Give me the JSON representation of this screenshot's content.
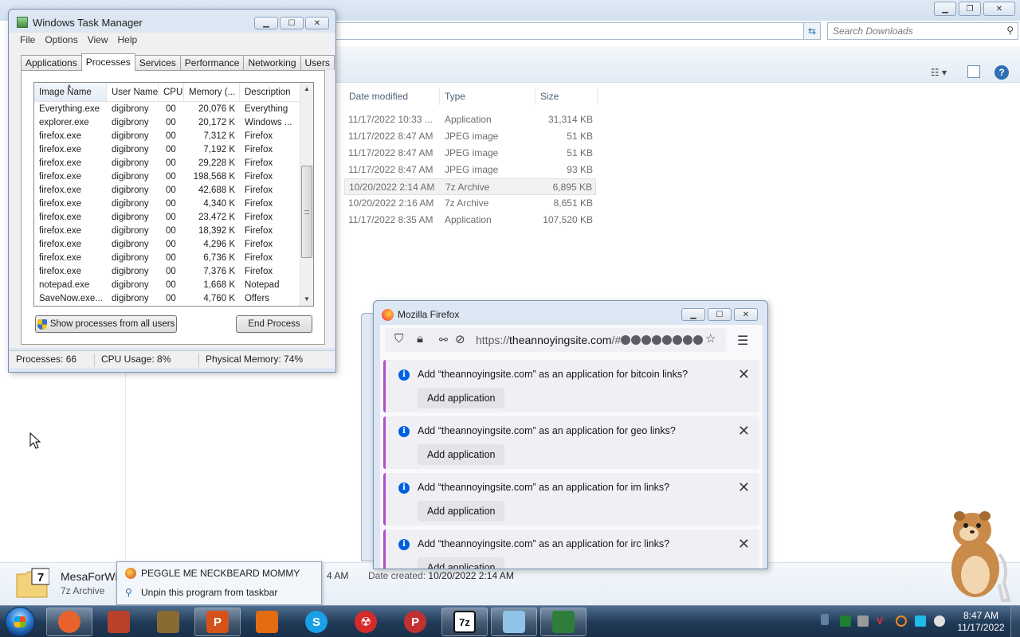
{
  "explorer": {
    "search_placeholder": "Search Downloads",
    "columns": [
      "Date modified",
      "Type",
      "Size"
    ],
    "files": [
      {
        "date": "11/17/2022 10:33 ...",
        "type": "Application",
        "size": "31,314 KB"
      },
      {
        "date": "11/17/2022 8:47 AM",
        "type": "JPEG image",
        "size": "51 KB"
      },
      {
        "date": "11/17/2022 8:47 AM",
        "type": "JPEG image",
        "size": "51 KB"
      },
      {
        "date": "11/17/2022 8:47 AM",
        "type": "JPEG image",
        "size": "93 KB"
      },
      {
        "date": "10/20/2022 2:14 AM",
        "type": "7z Archive",
        "size": "6,895 KB"
      },
      {
        "date": "10/20/2022 2:16 AM",
        "type": "7z Archive",
        "size": "8,651 KB"
      },
      {
        "date": "11/17/2022 8:35 AM",
        "type": "Application",
        "size": "107,520 KB"
      }
    ],
    "details": {
      "file_name": "MesaForWin",
      "file_type": "7z Archive",
      "time_fragment": "4 AM",
      "date_created_label": "Date created:",
      "date_created_value": "10/20/2022 2:14 AM"
    }
  },
  "taskmgr": {
    "title": "Windows Task Manager",
    "menu": [
      "File",
      "Options",
      "View",
      "Help"
    ],
    "tabs": [
      "Applications",
      "Processes",
      "Services",
      "Performance",
      "Networking",
      "Users"
    ],
    "columns": [
      "Image Name",
      "User Name",
      "CPU",
      "Memory (...",
      "Description"
    ],
    "processes": [
      [
        "Everything.exe",
        "digibrony",
        "00",
        "20,076 K",
        "Everything"
      ],
      [
        "explorer.exe",
        "digibrony",
        "00",
        "20,172 K",
        "Windows ..."
      ],
      [
        "firefox.exe",
        "digibrony",
        "00",
        "7,312 K",
        "Firefox"
      ],
      [
        "firefox.exe",
        "digibrony",
        "00",
        "7,192 K",
        "Firefox"
      ],
      [
        "firefox.exe",
        "digibrony",
        "00",
        "29,228 K",
        "Firefox"
      ],
      [
        "firefox.exe",
        "digibrony",
        "00",
        "198,568 K",
        "Firefox"
      ],
      [
        "firefox.exe",
        "digibrony",
        "00",
        "42,688 K",
        "Firefox"
      ],
      [
        "firefox.exe",
        "digibrony",
        "00",
        "4,340 K",
        "Firefox"
      ],
      [
        "firefox.exe",
        "digibrony",
        "00",
        "23,472 K",
        "Firefox"
      ],
      [
        "firefox.exe",
        "digibrony",
        "00",
        "18,392 K",
        "Firefox"
      ],
      [
        "firefox.exe",
        "digibrony",
        "00",
        "4,296 K",
        "Firefox"
      ],
      [
        "firefox.exe",
        "digibrony",
        "00",
        "6,736 K",
        "Firefox"
      ],
      [
        "firefox.exe",
        "digibrony",
        "00",
        "7,376 K",
        "Firefox"
      ],
      [
        "notepad.exe",
        "digibrony",
        "00",
        "1,668 K",
        "Notepad"
      ],
      [
        "SaveNow.exe...",
        "digibrony",
        "00",
        "4,760 K",
        "Offers"
      ]
    ],
    "show_all_label": "Show processes from all users",
    "end_process_label": "End Process",
    "status": {
      "processes": "Processes: 66",
      "cpu": "CPU Usage: 8%",
      "memory": "Physical Memory: 74%"
    }
  },
  "firefox": {
    "title": "Mozilla Firefox",
    "url_prefix": "https://",
    "url_domain": "theannoyingsite.com",
    "url_suffix": "/#",
    "notifications": [
      {
        "message": "Add “theannoyingsite.com” as an application for bitcoin links?",
        "button": "Add application"
      },
      {
        "message": "Add “theannoyingsite.com” as an application for geo links?",
        "button": "Add application"
      },
      {
        "message": "Add “theannoyingsite.com” as an application for im links?",
        "button": "Add application"
      },
      {
        "message": "Add “theannoyingsite.com” as an application for irc links?",
        "button": "Add application"
      }
    ]
  },
  "jumplist": {
    "items": [
      "PEGGLE ME NECKBEARD MOMMY",
      "Unpin this program from taskbar"
    ]
  },
  "taskbar": {
    "clock_time": "8:47 AM",
    "clock_date": "11/17/2022",
    "apps": [
      {
        "icon": "firefox-icon",
        "open": true,
        "color": "#e8632b"
      },
      {
        "icon": "angry-birds-icon",
        "open": false,
        "color": "#b8412b"
      },
      {
        "icon": "box-game-icon",
        "open": false,
        "color": "#8a6a33"
      },
      {
        "icon": "peggle-icon",
        "open": true,
        "color": "#d6521b"
      },
      {
        "icon": "orange-app-icon",
        "open": false,
        "color": "#e36b12"
      },
      {
        "icon": "skype-icon",
        "open": false,
        "color": "#1aa0e8"
      },
      {
        "icon": "radiation-icon",
        "open": false,
        "color": "#d62a2a"
      },
      {
        "icon": "peggle-nights-icon",
        "open": false,
        "color": "#c2302f"
      },
      {
        "icon": "7zip-icon",
        "open": true,
        "color": "#1e1e1e"
      },
      {
        "icon": "notepad-icon",
        "open": true,
        "color": "#8fc3e8"
      },
      {
        "icon": "task-manager-icon",
        "open": true,
        "color": "#2e7d3a"
      }
    ]
  }
}
